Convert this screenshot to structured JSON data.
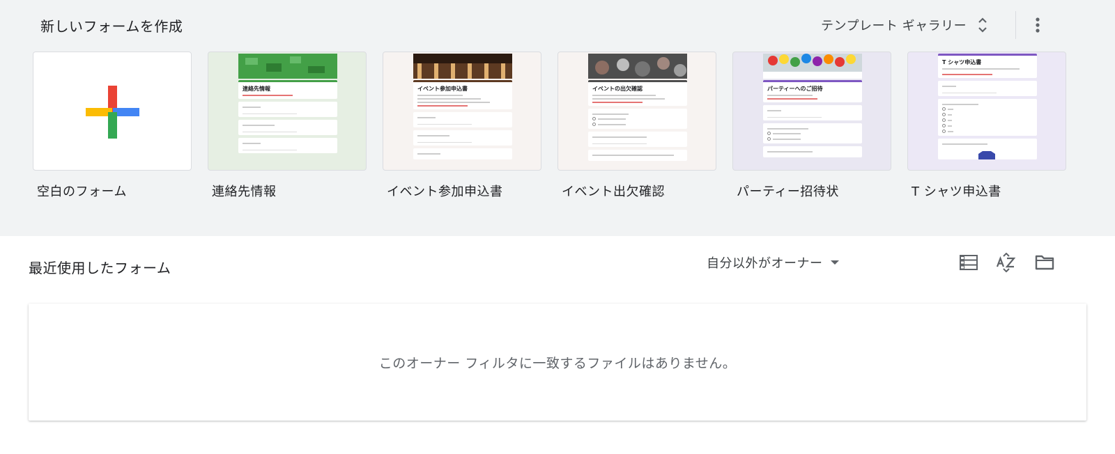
{
  "new_form": {
    "title": "新しいフォームを作成",
    "gallery_label": "テンプレート ギャラリー",
    "templates": [
      {
        "label": "空白のフォーム"
      },
      {
        "label": "連絡先情報",
        "preview_title": "連絡先情報",
        "bg": "#e6efe3",
        "header": "#43a047"
      },
      {
        "label": "イベント参加申込書",
        "preview_title": "イベント参加申込書",
        "bg": "#f7f3f1",
        "header": "#5d3a22"
      },
      {
        "label": "イベント出欠確認",
        "preview_title": "イベントの出欠確認",
        "bg": "#f7f3f1",
        "header": "#4e4e4e"
      },
      {
        "label": "パーティー招待状",
        "preview_title": "パーティーへのご招待",
        "bg": "#e9e7f2",
        "header": "#7e57c2"
      },
      {
        "label": "T シャツ申込書",
        "preview_title": "T シャツ申込書",
        "bg": "#ece8f6",
        "header": "#7e57c2"
      }
    ]
  },
  "recent": {
    "title": "最近使用したフォーム",
    "owner_filter": "自分以外がオーナー",
    "empty_message": "このオーナー フィルタに一致するファイルはありません。"
  },
  "colors": {
    "section_bg": "#f1f3f4",
    "plus_red": "#ea4335",
    "plus_blue": "#4285f4",
    "plus_yellow": "#fbbc04",
    "plus_green": "#34a853"
  }
}
